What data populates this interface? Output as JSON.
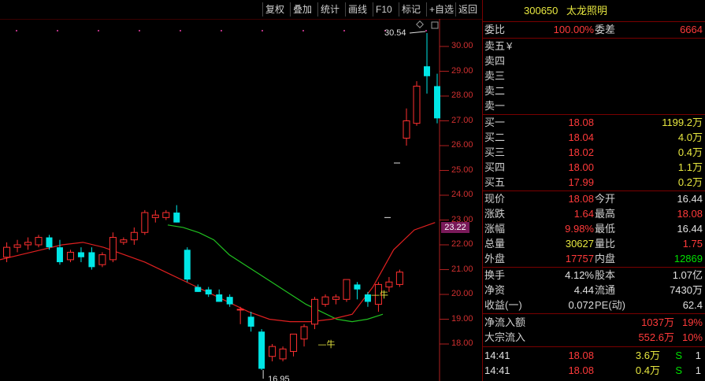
{
  "toolbar": {
    "buttons": [
      "复权",
      "叠加",
      "统计",
      "画线",
      "F10",
      "标记",
      "+自选",
      "返回"
    ]
  },
  "stock": {
    "code": "300650",
    "name": "太龙照明"
  },
  "chart_data": {
    "type": "candlestick",
    "y_ticks": [
      "30.00",
      "29.00",
      "28.00",
      "27.00",
      "26.00",
      "25.00",
      "24.00",
      "23.00",
      "22.00",
      "21.00",
      "20.00",
      "19.00",
      "18.00"
    ],
    "ylim": [
      17.1,
      31.6
    ],
    "current_price_label": "23.22",
    "high_annotation": "30.54",
    "low_annotation": "16.95",
    "markers": [
      "牛",
      "牛"
    ],
    "candles": [
      {
        "o": 21.5,
        "h": 22.1,
        "l": 21.3,
        "c": 21.9
      },
      {
        "o": 21.9,
        "h": 22.2,
        "l": 21.7,
        "c": 22.0
      },
      {
        "o": 22.0,
        "h": 22.3,
        "l": 21.8,
        "c": 22.1
      },
      {
        "o": 22.0,
        "h": 22.4,
        "l": 21.9,
        "c": 22.3
      },
      {
        "o": 22.3,
        "h": 22.4,
        "l": 21.8,
        "c": 21.9
      },
      {
        "o": 21.9,
        "h": 22.2,
        "l": 21.2,
        "c": 21.3
      },
      {
        "o": 21.4,
        "h": 21.8,
        "l": 21.3,
        "c": 21.7
      },
      {
        "o": 21.7,
        "h": 21.9,
        "l": 21.3,
        "c": 21.5
      },
      {
        "o": 21.7,
        "h": 21.9,
        "l": 21.0,
        "c": 21.1
      },
      {
        "o": 21.2,
        "h": 21.7,
        "l": 21.1,
        "c": 21.6
      },
      {
        "o": 21.4,
        "h": 22.5,
        "l": 21.3,
        "c": 22.3
      },
      {
        "o": 22.1,
        "h": 22.3,
        "l": 22.0,
        "c": 22.2
      },
      {
        "o": 22.2,
        "h": 22.7,
        "l": 22.0,
        "c": 22.5
      },
      {
        "o": 22.5,
        "h": 23.4,
        "l": 22.4,
        "c": 23.3
      },
      {
        "o": 23.1,
        "h": 23.4,
        "l": 22.9,
        "c": 23.2
      },
      {
        "o": 23.1,
        "h": 23.4,
        "l": 23.0,
        "c": 23.3
      },
      {
        "o": 23.3,
        "h": 23.6,
        "l": 22.9,
        "c": 22.9
      },
      {
        "o": 21.8,
        "h": 21.9,
        "l": 20.5,
        "c": 20.6
      },
      {
        "o": 20.3,
        "h": 20.4,
        "l": 20.1,
        "c": 20.1
      },
      {
        "o": 20.2,
        "h": 20.3,
        "l": 19.9,
        "c": 20.0
      },
      {
        "o": 20.0,
        "h": 20.2,
        "l": 19.7,
        "c": 19.7
      },
      {
        "o": 19.9,
        "h": 20.0,
        "l": 19.5,
        "c": 19.6
      },
      {
        "o": 19.4,
        "h": 19.5,
        "l": 18.8,
        "c": 19.4
      },
      {
        "o": 19.1,
        "h": 19.3,
        "l": 18.5,
        "c": 18.7
      },
      {
        "o": 18.5,
        "h": 18.6,
        "l": 16.95,
        "c": 17.0
      },
      {
        "o": 17.5,
        "h": 18.0,
        "l": 17.3,
        "c": 17.9
      },
      {
        "o": 17.4,
        "h": 17.9,
        "l": 17.3,
        "c": 17.8
      },
      {
        "o": 17.7,
        "h": 18.4,
        "l": 17.5,
        "c": 18.4
      },
      {
        "o": 18.2,
        "h": 18.8,
        "l": 17.9,
        "c": 18.7
      },
      {
        "o": 18.8,
        "h": 19.9,
        "l": 18.6,
        "c": 19.8
      },
      {
        "o": 19.6,
        "h": 20.0,
        "l": 19.5,
        "c": 19.9
      },
      {
        "o": 19.8,
        "h": 20.0,
        "l": 19.6,
        "c": 19.9
      },
      {
        "o": 19.8,
        "h": 20.6,
        "l": 19.7,
        "c": 20.6
      },
      {
        "o": 20.4,
        "h": 20.5,
        "l": 19.8,
        "c": 20.2
      },
      {
        "o": 20.0,
        "h": 20.1,
        "l": 19.5,
        "c": 19.7
      },
      {
        "o": 19.6,
        "h": 20.5,
        "l": 19.3,
        "c": 20.4
      },
      {
        "o": 20.3,
        "h": 20.7,
        "l": 20.1,
        "c": 20.5
      },
      {
        "o": 20.4,
        "h": 21.0,
        "l": 20.3,
        "c": 20.9
      },
      {
        "o": 26.3,
        "h": 27.5,
        "l": 26.0,
        "c": 27.0
      },
      {
        "o": 26.9,
        "h": 28.6,
        "l": 26.8,
        "c": 28.4
      },
      {
        "o": 29.2,
        "h": 30.54,
        "l": 28.1,
        "c": 28.8
      },
      {
        "o": 28.4,
        "h": 28.9,
        "l": 26.9,
        "c": 27.1
      }
    ],
    "ma_green": [
      22.8,
      22.7,
      22.5,
      22.2,
      21.6,
      21.2,
      20.8,
      20.4,
      20.0,
      19.6,
      19.3,
      19.0,
      18.9,
      19.0,
      19.2
    ],
    "ma_red": [
      21.4,
      21.6,
      21.8,
      22.0,
      22.1,
      21.9,
      21.6,
      21.3,
      20.9,
      20.5,
      20.1,
      19.7,
      19.3,
      19.0,
      18.9,
      18.9,
      19.0,
      19.2,
      20.3,
      21.8,
      22.6,
      22.9
    ]
  },
  "quote": {
    "wei_bi_label": "委比",
    "wei_bi": "100.00%",
    "wei_cha_label": "委差",
    "wei_cha": "6664",
    "asks": [
      {
        "label": "卖五",
        "price": "",
        "vol": "",
        "unit": "¥"
      },
      {
        "label": "卖四",
        "price": "",
        "vol": ""
      },
      {
        "label": "卖三",
        "price": "",
        "vol": ""
      },
      {
        "label": "卖二",
        "price": "",
        "vol": ""
      },
      {
        "label": "卖一",
        "price": "",
        "vol": ""
      }
    ],
    "bids": [
      {
        "label": "买一",
        "price": "18.08",
        "vol": "1199.2万"
      },
      {
        "label": "买二",
        "price": "18.04",
        "vol": "4.0万"
      },
      {
        "label": "买三",
        "price": "18.02",
        "vol": "0.4万"
      },
      {
        "label": "买四",
        "price": "18.00",
        "vol": "1.1万"
      },
      {
        "label": "买五",
        "price": "17.99",
        "vol": "0.2万"
      }
    ],
    "stats": [
      {
        "l1": "现价",
        "v1": "18.08",
        "c1": "red",
        "l2": "今开",
        "v2": "16.44",
        "c2": "white"
      },
      {
        "l1": "涨跌",
        "v1": "1.64",
        "c1": "red",
        "l2": "最高",
        "v2": "18.08",
        "c2": "red"
      },
      {
        "l1": "涨幅",
        "v1": "9.98%",
        "c1": "red",
        "l2": "最低",
        "v2": "16.44",
        "c2": "white"
      },
      {
        "l1": "总量",
        "v1": "30627",
        "c1": "yellow",
        "l2": "量比",
        "v2": "1.75",
        "c2": "red"
      },
      {
        "l1": "外盘",
        "v1": "17757",
        "c1": "red",
        "l2": "内盘",
        "v2": "12869",
        "c2": "green"
      }
    ],
    "stats2": [
      {
        "l1": "换手",
        "v1": "4.12%",
        "c1": "white",
        "l2": "股本",
        "v2": "1.07亿",
        "c2": "white"
      },
      {
        "l1": "净资",
        "v1": "4.44",
        "c1": "white",
        "l2": "流通",
        "v2": "7430万",
        "c2": "white"
      },
      {
        "l1": "收益(一)",
        "v1": "0.072",
        "c1": "white",
        "l2": "PE(动)",
        "v2": "62.4",
        "c2": "white"
      }
    ],
    "flows": [
      {
        "label": "净流入额",
        "amount": "1037万",
        "pct": "19%"
      },
      {
        "label": "大宗流入",
        "amount": "552.6万",
        "pct": "10%"
      }
    ],
    "ticks": [
      {
        "time": "14:41",
        "price": "18.08",
        "vol": "3.6万",
        "side": "S",
        "count": "1"
      },
      {
        "time": "14:41",
        "price": "18.08",
        "vol": "0.4万",
        "side": "S",
        "count": "1"
      }
    ]
  }
}
